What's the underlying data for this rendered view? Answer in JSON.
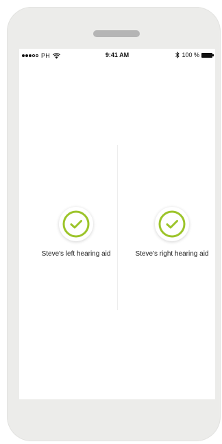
{
  "status_bar": {
    "carrier": "PH",
    "time": "9:41 AM",
    "battery": "100 %",
    "signal_bars_filled": 3,
    "signal_bars_total": 5
  },
  "hearing_aids": {
    "left": {
      "label": "Steve's left hearing aid",
      "status": "connected"
    },
    "right": {
      "label": "Steve's right hearing aid",
      "status": "connected"
    }
  },
  "colors": {
    "accent": "#9cc42a",
    "device_frame": "#ececea",
    "screen": "#ffffff"
  }
}
